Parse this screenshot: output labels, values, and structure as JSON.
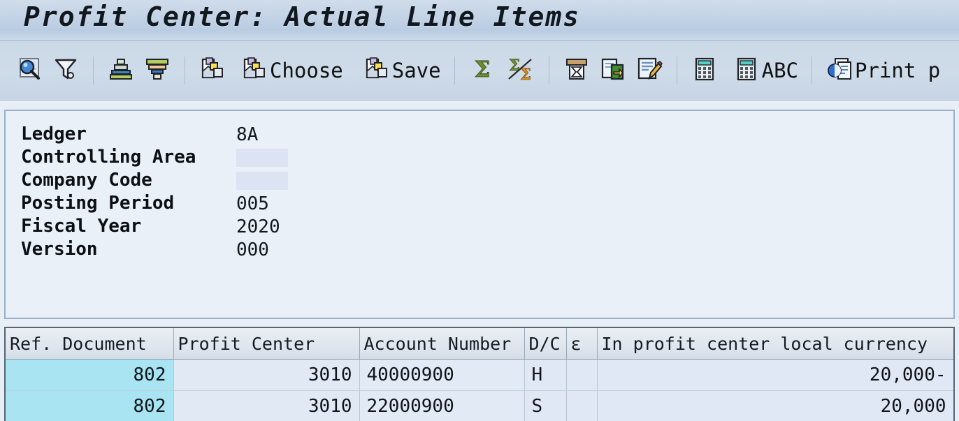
{
  "window": {
    "title": "Profit Center: Actual Line Items"
  },
  "toolbar": {
    "items": [
      {
        "id": "display-detail",
        "icon": "magnifier-detail-icon",
        "label": ""
      },
      {
        "id": "set-filter",
        "icon": "filter-funnel-icon",
        "label": ""
      },
      {
        "id": "sort-ascending",
        "icon": "sort-ascending-icon",
        "label": ""
      },
      {
        "id": "sort-descending",
        "icon": "sort-descending-icon",
        "label": ""
      },
      {
        "id": "select-layout",
        "icon": "choose-layout-icon",
        "label": ""
      },
      {
        "id": "choose",
        "icon": "choose-layout-icon",
        "label": "Choose"
      },
      {
        "id": "save",
        "icon": "save-layout-icon",
        "label": "Save"
      },
      {
        "id": "total",
        "icon": "sigma-total-icon",
        "label": ""
      },
      {
        "id": "subtotal",
        "icon": "sigma-subtotal-icon",
        "label": ""
      },
      {
        "id": "print-filter",
        "icon": "hourglass-filter-icon",
        "label": ""
      },
      {
        "id": "export",
        "icon": "export-arrow-icon",
        "label": ""
      },
      {
        "id": "change-layout",
        "icon": "edit-pencil-icon",
        "label": ""
      },
      {
        "id": "calculator",
        "icon": "calculator-icon",
        "label": ""
      },
      {
        "id": "abc",
        "icon": "calculator-icon",
        "label": "ABC"
      },
      {
        "id": "print-preview",
        "icon": "print-preview-icon",
        "label": "Print p"
      }
    ]
  },
  "header_panel": {
    "fields": [
      {
        "label": "Ledger",
        "value": "8A",
        "type": "text"
      },
      {
        "label": "Controlling Area",
        "value": "",
        "type": "input"
      },
      {
        "label": "Company Code",
        "value": "",
        "type": "input"
      },
      {
        "label": "Posting Period",
        "value": "005",
        "type": "text"
      },
      {
        "label": "Fiscal Year",
        "value": "2020",
        "type": "text"
      },
      {
        "label": "Version",
        "value": "000",
        "type": "text"
      }
    ]
  },
  "grid": {
    "columns": [
      {
        "key": "ref_document",
        "label": "Ref. Document"
      },
      {
        "key": "profit_center",
        "label": "Profit Center"
      },
      {
        "key": "account_number",
        "label": "Account Number"
      },
      {
        "key": "debit_credit",
        "label": "D/C"
      },
      {
        "key": "sigma",
        "label": "ε"
      },
      {
        "key": "amount_local",
        "label": "In profit center local currency"
      }
    ],
    "rows": [
      {
        "ref_document": "802",
        "profit_center": "3010",
        "account_number": "40000900",
        "debit_credit": "H",
        "sigma": "",
        "amount_local": "20,000-"
      },
      {
        "ref_document": "802",
        "profit_center": "3010",
        "account_number": "22000900",
        "debit_credit": "S",
        "sigma": "",
        "amount_local": "20,000"
      }
    ]
  },
  "colors": {
    "title_bar": "#c3d3e6",
    "toolbar": "#ccd9e8",
    "panel_bg": "#eaf0f7",
    "input_bg": "#dce3f2",
    "ref_column": "#a8e4f2",
    "row_bg": "#dfe8f4",
    "grid_border": "#556573"
  }
}
